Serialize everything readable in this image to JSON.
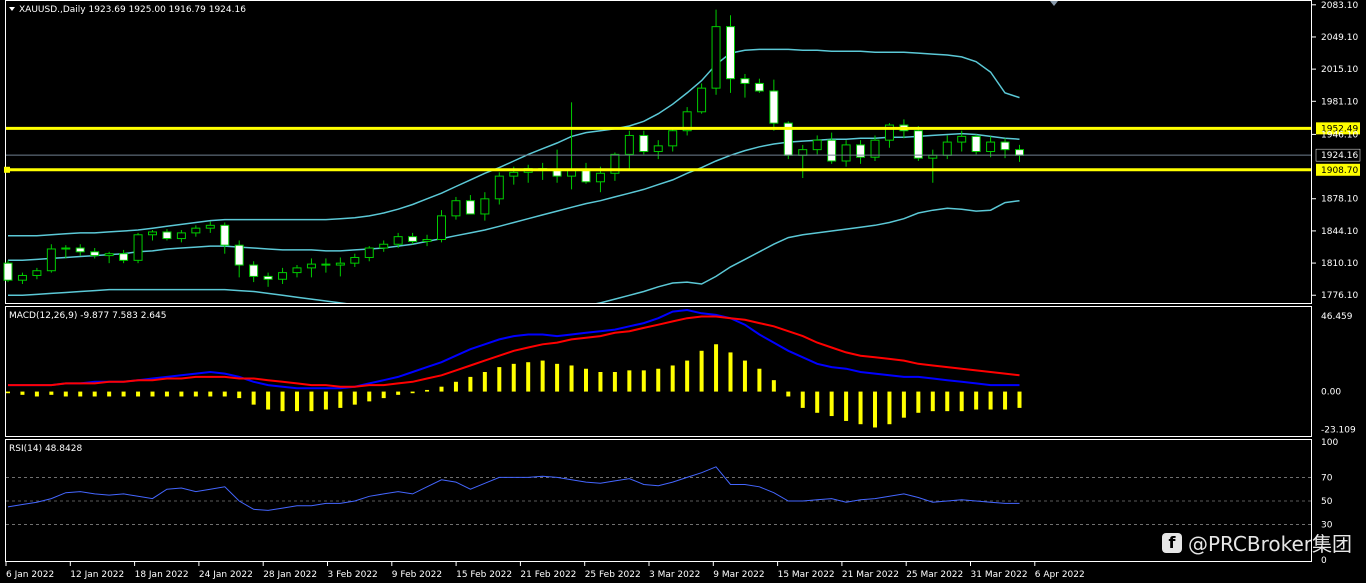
{
  "chart_data": {
    "type": "candlestick",
    "symbol_header": "XAUUSD.,Daily  1923.69 1925.00 1916.79 1924.16",
    "price_ticks": [
      "2083.10",
      "2049.10",
      "2015.10",
      "1981.10",
      "1946.10",
      "1878.10",
      "1844.10",
      "1810.10",
      "1776.10"
    ],
    "price_range": [
      1770,
      2085
    ],
    "levels": [
      {
        "label": "1952.49",
        "value": 1952.49,
        "color": "#ffff00"
      },
      {
        "label": "1908.70",
        "value": 1908.7,
        "color": "#ffff00"
      }
    ],
    "current_price": {
      "label": "1924.16",
      "value": 1924.16
    },
    "dates": [
      "6 Jan 2022",
      "12 Jan 2022",
      "18 Jan 2022",
      "24 Jan 2022",
      "28 Jan 2022",
      "3 Feb 2022",
      "9 Feb 2022",
      "15 Feb 2022",
      "21 Feb 2022",
      "25 Feb 2022",
      "3 Mar 2022",
      "9 Mar 2022",
      "15 Mar 2022",
      "21 Mar 2022",
      "25 Mar 2022",
      "31 Mar 2022",
      "6 Apr 2022"
    ],
    "candles": [
      [
        1810,
        1813,
        1790,
        1792
      ],
      [
        1792,
        1800,
        1788,
        1797
      ],
      [
        1797,
        1805,
        1793,
        1802
      ],
      [
        1802,
        1830,
        1800,
        1825
      ],
      [
        1825,
        1829,
        1815,
        1826
      ],
      [
        1826,
        1830,
        1818,
        1822
      ],
      [
        1822,
        1826,
        1815,
        1818
      ],
      [
        1818,
        1822,
        1810,
        1820
      ],
      [
        1820,
        1824,
        1810,
        1813
      ],
      [
        1813,
        1842,
        1810,
        1840
      ],
      [
        1840,
        1845,
        1834,
        1843
      ],
      [
        1843,
        1846,
        1834,
        1836
      ],
      [
        1836,
        1845,
        1832,
        1842
      ],
      [
        1842,
        1850,
        1838,
        1847
      ],
      [
        1847,
        1854,
        1842,
        1850
      ],
      [
        1850,
        1853,
        1820,
        1829
      ],
      [
        1829,
        1834,
        1795,
        1808
      ],
      [
        1808,
        1812,
        1790,
        1796
      ],
      [
        1796,
        1800,
        1785,
        1793
      ],
      [
        1793,
        1805,
        1788,
        1800
      ],
      [
        1800,
        1808,
        1795,
        1805
      ],
      [
        1805,
        1815,
        1795,
        1809
      ],
      [
        1809,
        1815,
        1800,
        1808
      ],
      [
        1808,
        1816,
        1796,
        1810
      ],
      [
        1810,
        1820,
        1806,
        1816
      ],
      [
        1816,
        1828,
        1812,
        1826
      ],
      [
        1826,
        1834,
        1822,
        1830
      ],
      [
        1830,
        1842,
        1826,
        1838
      ],
      [
        1838,
        1842,
        1830,
        1833
      ],
      [
        1833,
        1840,
        1828,
        1835
      ],
      [
        1835,
        1866,
        1832,
        1860
      ],
      [
        1860,
        1880,
        1856,
        1876
      ],
      [
        1876,
        1882,
        1862,
        1862
      ],
      [
        1862,
        1885,
        1855,
        1878
      ],
      [
        1878,
        1906,
        1872,
        1902
      ],
      [
        1902,
        1912,
        1893,
        1906
      ],
      [
        1906,
        1914,
        1895,
        1910
      ],
      [
        1910,
        1916,
        1898,
        1908
      ],
      [
        1908,
        1930,
        1895,
        1902
      ],
      [
        1902,
        1980,
        1888,
        1908
      ],
      [
        1908,
        1916,
        1894,
        1896
      ],
      [
        1896,
        1912,
        1885,
        1905
      ],
      [
        1905,
        1927,
        1897,
        1925
      ],
      [
        1925,
        1950,
        1908,
        1945
      ],
      [
        1945,
        1950,
        1925,
        1928
      ],
      [
        1928,
        1940,
        1920,
        1934
      ],
      [
        1934,
        1952,
        1928,
        1950
      ],
      [
        1950,
        1975,
        1945,
        1970
      ],
      [
        1970,
        2000,
        1968,
        1995
      ],
      [
        1995,
        2078,
        1988,
        2060
      ],
      [
        2060,
        2072,
        1990,
        2005
      ],
      [
        2005,
        2010,
        1985,
        2000
      ],
      [
        2000,
        2005,
        1990,
        1992
      ],
      [
        1992,
        2004,
        1950,
        1958
      ],
      [
        1958,
        1960,
        1920,
        1924
      ],
      [
        1924,
        1935,
        1900,
        1930
      ],
      [
        1930,
        1945,
        1925,
        1940
      ],
      [
        1940,
        1948,
        1915,
        1918
      ],
      [
        1918,
        1940,
        1912,
        1935
      ],
      [
        1935,
        1940,
        1915,
        1922
      ],
      [
        1922,
        1945,
        1918,
        1940
      ],
      [
        1940,
        1958,
        1932,
        1956
      ],
      [
        1956,
        1962,
        1942,
        1950
      ],
      [
        1950,
        1955,
        1918,
        1921
      ],
      [
        1921,
        1930,
        1895,
        1924
      ],
      [
        1924,
        1945,
        1920,
        1938
      ],
      [
        1938,
        1950,
        1928,
        1944
      ],
      [
        1944,
        1946,
        1925,
        1928
      ],
      [
        1928,
        1944,
        1922,
        1938
      ],
      [
        1938,
        1942,
        1921,
        1930
      ],
      [
        1930,
        1935,
        1917,
        1924
      ]
    ],
    "bollinger": {
      "upper": [
        1839,
        1839,
        1839,
        1840,
        1841,
        1842,
        1842,
        1843,
        1844,
        1845,
        1847,
        1849,
        1851,
        1853,
        1855,
        1856,
        1856,
        1856,
        1856,
        1856,
        1856,
        1856,
        1856,
        1857,
        1858,
        1860,
        1863,
        1867,
        1872,
        1878,
        1884,
        1891,
        1898,
        1905,
        1911,
        1918,
        1925,
        1931,
        1937,
        1944,
        1948,
        1950,
        1952,
        1955,
        1960,
        1968,
        1978,
        1990,
        2003,
        2020,
        2032,
        2035,
        2036,
        2036,
        2036,
        2035,
        2035,
        2034,
        2034,
        2034,
        2033,
        2033,
        2033,
        2032,
        2031,
        2030,
        2028,
        2023,
        2012,
        1990,
        1985
      ],
      "middle": [
        1813,
        1813,
        1814,
        1815,
        1816,
        1817,
        1818,
        1819,
        1820,
        1822,
        1823,
        1825,
        1826,
        1827,
        1828,
        1828,
        1827,
        1826,
        1825,
        1824,
        1824,
        1824,
        1823,
        1823,
        1824,
        1825,
        1826,
        1828,
        1830,
        1833,
        1836,
        1839,
        1842,
        1845,
        1849,
        1853,
        1857,
        1861,
        1865,
        1869,
        1873,
        1876,
        1880,
        1884,
        1888,
        1893,
        1898,
        1905,
        1911,
        1918,
        1924,
        1929,
        1933,
        1936,
        1938,
        1939,
        1940,
        1941,
        1941,
        1942,
        1942,
        1943,
        1943,
        1944,
        1945,
        1946,
        1947,
        1946,
        1944,
        1942,
        1941
      ],
      "lower": [
        1776,
        1776,
        1777,
        1778,
        1779,
        1780,
        1781,
        1782,
        1782,
        1782,
        1782,
        1782,
        1782,
        1782,
        1782,
        1782,
        1781,
        1780,
        1778,
        1776,
        1774,
        1772,
        1770,
        1768,
        1766,
        1764,
        1762,
        1760,
        1758,
        1756,
        1754,
        1752,
        1750,
        1748,
        1747,
        1747,
        1748,
        1750,
        1755,
        1760,
        1765,
        1768,
        1772,
        1776,
        1780,
        1785,
        1789,
        1790,
        1788,
        1796,
        1806,
        1814,
        1822,
        1830,
        1837,
        1840,
        1842,
        1844,
        1846,
        1848,
        1850,
        1853,
        1857,
        1863,
        1866,
        1868,
        1867,
        1865,
        1866,
        1874,
        1876
      ]
    },
    "macd": {
      "label": "MACD(12,26,9) -9.877 7.583 2.645",
      "ticks": [
        "46.459",
        "0.00",
        "-23.109"
      ],
      "range": [
        -26,
        50
      ],
      "histogram": [
        -1,
        -2,
        -3,
        -2,
        -3,
        -3,
        -3,
        -3,
        -3,
        -3,
        -3,
        -3,
        -3,
        -3,
        -3,
        -3,
        -4,
        -8,
        -11,
        -12,
        -12,
        -12,
        -11,
        -10,
        -8,
        -6,
        -4,
        -2,
        -1,
        1,
        3,
        6,
        9,
        12,
        15,
        17,
        18,
        19,
        17,
        16,
        14,
        12,
        12,
        13,
        13,
        14,
        16,
        19,
        25,
        29,
        24,
        19,
        14,
        7,
        -3,
        -10,
        -13,
        -15,
        -18,
        -20,
        -22,
        -20,
        -16,
        -13,
        -12,
        -12,
        -12,
        -11,
        -11,
        -11,
        -10
      ],
      "macd_line": [
        4,
        4,
        4,
        4,
        5,
        5,
        6,
        6,
        6,
        7,
        8,
        9,
        10,
        11,
        12,
        11,
        9,
        6,
        4,
        3,
        2,
        2,
        2,
        2,
        3,
        5,
        7,
        9,
        12,
        15,
        18,
        22,
        26,
        29,
        32,
        34,
        35,
        35,
        34,
        35,
        36,
        37,
        38,
        40,
        42,
        45,
        49,
        50,
        48,
        47,
        45,
        41,
        35,
        30,
        25,
        21,
        17,
        15,
        14,
        12,
        11,
        10,
        9,
        9,
        8,
        7,
        6,
        5,
        4,
        4,
        4
      ],
      "signal_line": [
        4,
        4,
        4,
        4,
        5,
        5,
        5,
        6,
        6,
        7,
        7,
        8,
        8,
        9,
        9,
        9,
        8,
        8,
        7,
        6,
        5,
        4,
        4,
        3,
        3,
        4,
        4,
        5,
        6,
        8,
        10,
        13,
        16,
        19,
        22,
        25,
        27,
        29,
        30,
        32,
        33,
        34,
        36,
        37,
        39,
        41,
        43,
        45,
        46,
        46,
        45,
        44,
        42,
        40,
        37,
        34,
        30,
        27,
        24,
        22,
        21,
        20,
        19,
        17,
        16,
        15,
        14,
        13,
        12,
        11,
        10
      ]
    },
    "rsi": {
      "label": "RSI(14) 48.8428",
      "ticks": [
        "100",
        "70",
        "50",
        "30",
        "0"
      ],
      "levels": [
        70,
        50,
        30
      ],
      "values": [
        45,
        47,
        49,
        52,
        57,
        58,
        56,
        55,
        56,
        54,
        52,
        60,
        61,
        58,
        60,
        62,
        50,
        43,
        42,
        44,
        46,
        46,
        48,
        48,
        50,
        54,
        56,
        58,
        56,
        62,
        68,
        66,
        60,
        65,
        70,
        70,
        70,
        71,
        70,
        68,
        66,
        65,
        67,
        69,
        64,
        63,
        66,
        70,
        74,
        79,
        64,
        64,
        62,
        57,
        50,
        50,
        51,
        52,
        49,
        51,
        52,
        54,
        56,
        53,
        49,
        50,
        51,
        50,
        49,
        48,
        48
      ]
    },
    "colors": {
      "bull_body": "#000000",
      "bull_outline": "#00cc00",
      "bear_body": "#ffffff",
      "bear_outline": "#00cc00",
      "bollinger": "#5bc8d6",
      "level": "#ffff00",
      "macd_hist": "#ffff00",
      "macd_line": "#0000ff",
      "signal_line": "#ff0000",
      "rsi_line": "#4466ff",
      "grid": "#ffffff"
    }
  },
  "watermark": {
    "icon": "facebook-icon",
    "text": "@PRCBroker集团"
  }
}
